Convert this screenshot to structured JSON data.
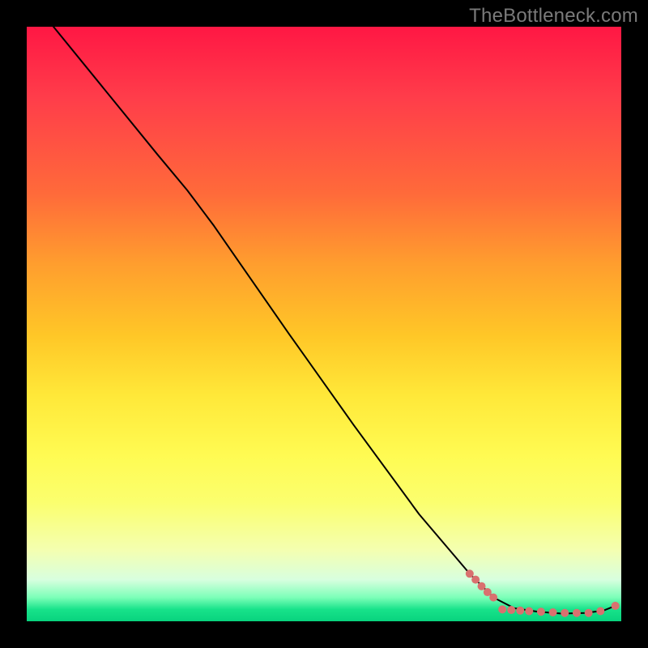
{
  "watermark": "TheBottleneck.com",
  "chart_data": {
    "type": "line",
    "title": "",
    "xlabel": "",
    "ylabel": "",
    "xlim": [
      0,
      100
    ],
    "ylim": [
      0,
      100
    ],
    "series": [
      {
        "name": "curve",
        "type": "line",
        "style": {
          "color": "#000000",
          "width": 2
        },
        "points": [
          {
            "x": 4.5,
            "y": 100.0
          },
          {
            "x": 22.0,
            "y": 78.5
          },
          {
            "x": 27.0,
            "y": 72.5
          },
          {
            "x": 31.5,
            "y": 66.5
          },
          {
            "x": 36.0,
            "y": 60.0
          },
          {
            "x": 44.0,
            "y": 48.5
          },
          {
            "x": 55.0,
            "y": 33.0
          },
          {
            "x": 66.0,
            "y": 18.0
          },
          {
            "x": 74.5,
            "y": 8.0
          },
          {
            "x": 78.5,
            "y": 4.0
          },
          {
            "x": 82.0,
            "y": 2.2
          },
          {
            "x": 86.0,
            "y": 1.6
          },
          {
            "x": 90.0,
            "y": 1.3
          },
          {
            "x": 94.0,
            "y": 1.4
          },
          {
            "x": 97.0,
            "y": 1.8
          },
          {
            "x": 99.0,
            "y": 2.6
          }
        ]
      },
      {
        "name": "markers",
        "type": "scatter",
        "style": {
          "color": "#d9716f",
          "radius": 5
        },
        "points": [
          {
            "x": 74.5,
            "y": 8.0
          },
          {
            "x": 75.5,
            "y": 7.0
          },
          {
            "x": 76.5,
            "y": 5.9
          },
          {
            "x": 77.5,
            "y": 4.9
          },
          {
            "x": 78.5,
            "y": 4.0
          },
          {
            "x": 80.0,
            "y": 2.0
          },
          {
            "x": 81.5,
            "y": 1.9
          },
          {
            "x": 83.0,
            "y": 1.8
          },
          {
            "x": 84.5,
            "y": 1.7
          },
          {
            "x": 86.5,
            "y": 1.6
          },
          {
            "x": 88.5,
            "y": 1.5
          },
          {
            "x": 90.5,
            "y": 1.4
          },
          {
            "x": 92.5,
            "y": 1.4
          },
          {
            "x": 94.5,
            "y": 1.4
          },
          {
            "x": 96.5,
            "y": 1.7
          },
          {
            "x": 99.0,
            "y": 2.6
          }
        ]
      }
    ]
  }
}
